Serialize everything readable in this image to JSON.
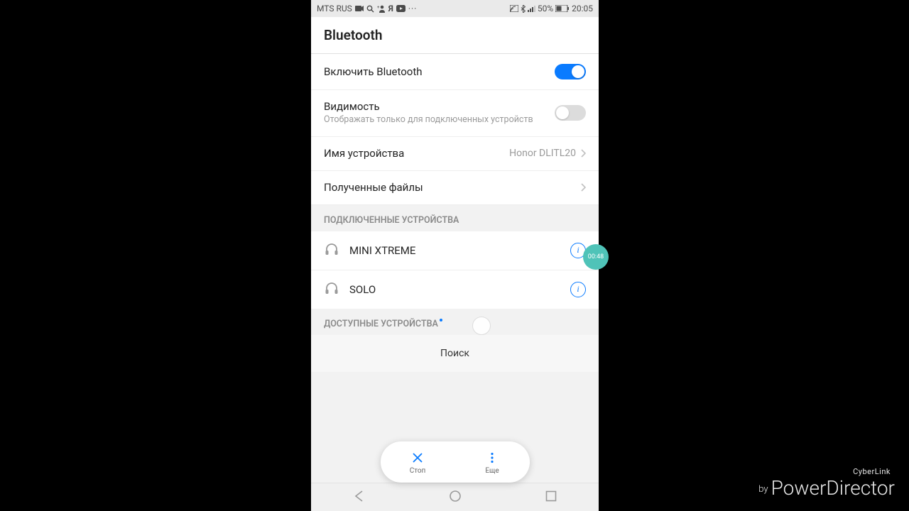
{
  "status": {
    "carrier": "MTS RUS",
    "battery": "50%",
    "time": "20:05"
  },
  "header": {
    "title": "Bluetooth"
  },
  "rows": {
    "enable": {
      "label": "Включить Bluetooth"
    },
    "visibility": {
      "label": "Видимость",
      "sub": "Отображать только для подключенных устройств"
    },
    "device_name": {
      "label": "Имя устройства",
      "value": "Honor DLITL20"
    },
    "received": {
      "label": "Полученные файлы"
    }
  },
  "sections": {
    "connected": "ПОДКЛЮЧЕННЫЕ УСТРОЙСТВА",
    "available": "ДОСТУПНЫЕ УСТРОЙСТВА"
  },
  "devices": {
    "connected": [
      {
        "name": "MINI XTREME"
      },
      {
        "name": "SOLO"
      }
    ]
  },
  "searching": "Поиск",
  "toolbar": {
    "stop": "Стоп",
    "more": "Еще"
  },
  "badge": {
    "time": "00:48"
  },
  "watermark": {
    "top": "CyberLink",
    "by": "by",
    "main": "PowerDirector"
  }
}
